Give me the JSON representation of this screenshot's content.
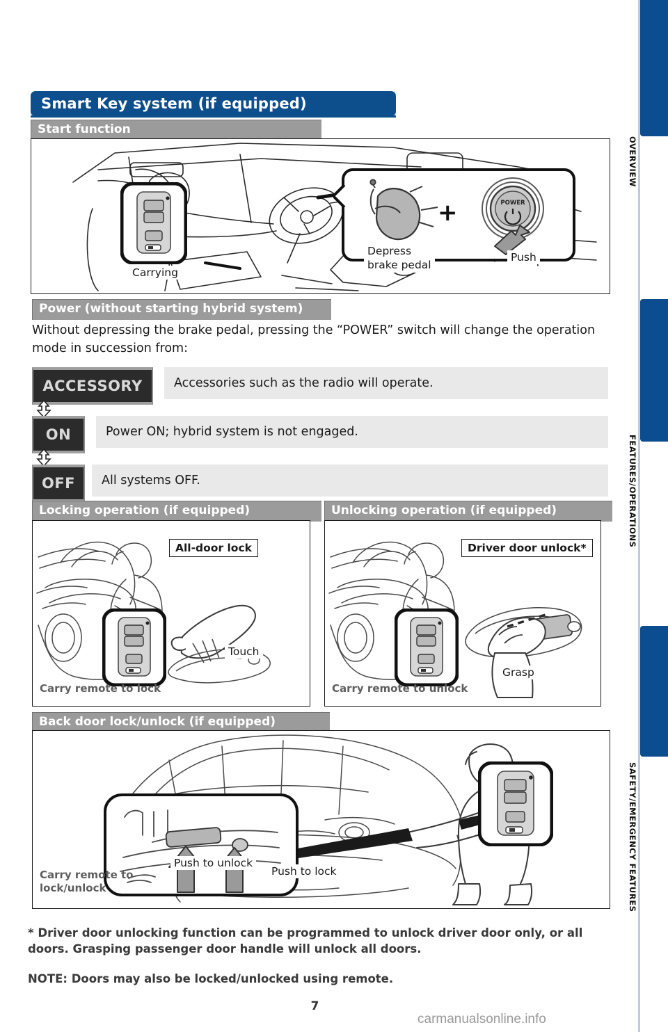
{
  "document": {
    "page_number": "7",
    "watermark": "carmanualsonline.info"
  },
  "title": "Smart Key system (if equipped)",
  "side_tabs": [
    {
      "label": "OVERVIEW"
    },
    {
      "label": "FEATURES/OPERATIONS"
    },
    {
      "label": "SAFETY/EMERGENCY FEATURES"
    }
  ],
  "sections": {
    "start": {
      "heading": "Start function",
      "carrying_caption": "Carrying",
      "brake_caption": "Depress\nbrake pedal",
      "push_caption": "Push",
      "plus_symbol": "+",
      "power_button_label": "POWER"
    },
    "power": {
      "heading": "Power (without starting hybrid system)",
      "intro": "Without depressing the brake pedal, pressing the “POWER” switch will change the operation mode in succession from:",
      "modes": [
        {
          "badge": "ACCESSORY",
          "description": "Accessories such as the radio will operate."
        },
        {
          "badge": "ON",
          "description": "Power ON; hybrid system is not engaged."
        },
        {
          "badge": "OFF",
          "description": "All systems OFF."
        }
      ]
    },
    "locking": {
      "heading": "Locking operation (if equipped)",
      "callout": "All-door lock",
      "action": "Touch",
      "caption": "Carry remote to lock"
    },
    "unlocking": {
      "heading": "Unlocking operation  (if equipped)",
      "callout": "Driver door unlock*",
      "action": "Grasp",
      "caption": "Carry remote to unlock"
    },
    "back_door": {
      "heading": "Back door lock/unlock (if equipped)",
      "unlock_label": "Push to unlock",
      "lock_label": "Push to lock",
      "caption": "Carry remote to\nlock/unlock"
    }
  },
  "footnotes": [
    "* Driver door unlocking function can be programmed to unlock driver door only, or all doors. Grasping passenger door handle will unlock all doors.",
    "NOTE: Doors may also be locked/unlocked using remote."
  ],
  "colors": {
    "title_blue": "#0d4e8c",
    "section_gray": "#9b9b9b",
    "desc_gray": "#e9e9e9",
    "badge_dark": "#2b2b2b",
    "tab_blue": "#0d5190"
  }
}
